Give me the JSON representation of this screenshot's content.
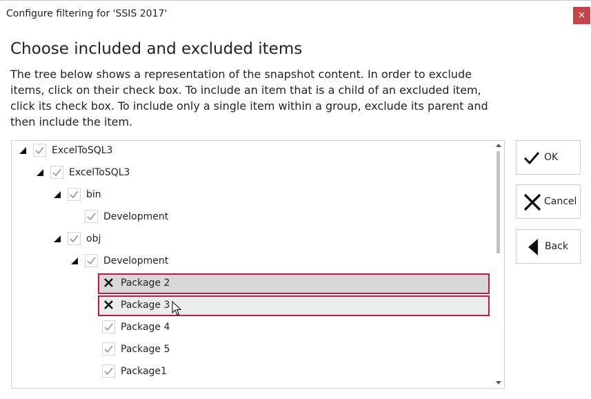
{
  "window": {
    "title": "Configure filtering for 'SSIS 2017'",
    "close_symbol": "×"
  },
  "heading": "Choose included and excluded items",
  "description": "The tree below shows a representation of the snapshot content. In order to exclude items, click on their check box. To include an item that is a child of an excluded item, click its check box. To include only a single item within a group, exclude its parent and then include the item.",
  "tree": {
    "items": [
      {
        "label": "ExcelToSQL3",
        "level": 0,
        "expanded": true,
        "state": "included"
      },
      {
        "label": "ExcelToSQL3",
        "level": 1,
        "expanded": true,
        "state": "included"
      },
      {
        "label": "bin",
        "level": 2,
        "expanded": true,
        "state": "included"
      },
      {
        "label": "Development",
        "level": 3,
        "expanded": false,
        "state": "included"
      },
      {
        "label": "obj",
        "level": 2,
        "expanded": true,
        "state": "included"
      },
      {
        "label": "Development",
        "level": 3,
        "expanded": true,
        "state": "included"
      },
      {
        "label": "Package 2",
        "level": 4,
        "expanded": false,
        "state": "excluded",
        "highlighted": true
      },
      {
        "label": "Package 3",
        "level": 4,
        "expanded": false,
        "state": "excluded",
        "highlighted": true
      },
      {
        "label": "Package 4",
        "level": 4,
        "expanded": false,
        "state": "included"
      },
      {
        "label": "Package 5",
        "level": 4,
        "expanded": false,
        "state": "included"
      },
      {
        "label": "Package1",
        "level": 4,
        "expanded": false,
        "state": "included"
      }
    ]
  },
  "buttons": {
    "ok": "OK",
    "cancel": "Cancel",
    "back": "Back"
  },
  "colors": {
    "close_button": "#c8424a",
    "highlight_border": "#c11a3a",
    "check_gray": "#9a9a9a"
  }
}
